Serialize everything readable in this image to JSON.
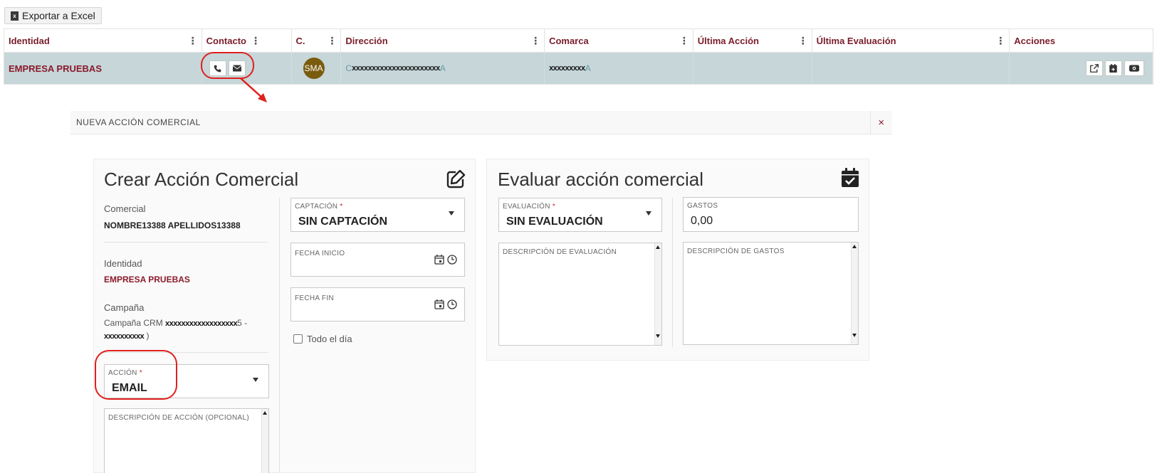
{
  "toolbar": {
    "export_label": "Exportar a Excel"
  },
  "grid": {
    "columns": [
      "Identidad",
      "Contacto",
      "C.",
      "Dirección",
      "Comarca",
      "Última Acción",
      "Última Evaluación",
      "Acciones"
    ],
    "row": {
      "identidad": "EMPRESA PRUEBAS",
      "avatar": "SMA",
      "direccion_masked": "xxxxxxxxxxxxxxxxxxxxxx",
      "direccion_prefix": "C",
      "direccion_tail": "A",
      "comarca_masked": "xxxxxxxxx",
      "comarca_tail": "A",
      "ultima_accion": "",
      "ultima_evaluacion": ""
    }
  },
  "dialog": {
    "title": "NUEVA ACCIÓN COMERCIAL",
    "close_glyph": "×",
    "create": {
      "title": "Crear Acción Comercial",
      "comercial_label": "Comercial",
      "comercial_value": "NOMBRE13388 APELLIDOS13388",
      "identidad_label": "Identidad",
      "identidad_value": "EMPRESA PRUEBAS",
      "campana_label": "Campaña",
      "campana_prefix": "Campaña CRM",
      "campana_masked_1": "xxxxxxxxxxxxxxxxxx",
      "campana_mid": "5 -",
      "campana_masked_2": "xxxxxxxxxx",
      "campana_suffix": ")",
      "accion_label": "ACCIÓN",
      "accion_value": "EMAIL",
      "descripcion_accion_label": "DESCRIPCIÓN DE ACCIÓN (OPCIONAL)",
      "captacion_label": "CAPTACIÓN",
      "captacion_value": "SIN CAPTACIÓN",
      "fecha_inicio_label": "FECHA INICIO",
      "fecha_fin_label": "FECHA FIN",
      "todo_dia_label": "Todo el día",
      "required_mark": "*"
    },
    "evaluate": {
      "title": "Evaluar acción comercial",
      "evaluacion_label": "EVALUACIÓN",
      "evaluacion_value": "SIN EVALUACIÓN",
      "gastos_label": "GASTOS",
      "gastos_value": "0,00",
      "descripcion_evaluacion_label": "DESCRIPCIÓN DE EVALUACIÓN",
      "descripcion_gastos_label": "DESCRIPCIÓN DE GASTOS"
    }
  },
  "colors": {
    "accent": "#8b1a2c",
    "row_bg": "#c6d6d9",
    "highlight": "#e0201c"
  },
  "icons": [
    "excel-icon",
    "kebab-icon",
    "phone-icon",
    "envelope-icon",
    "external-link-icon",
    "calendar-plus-icon",
    "eye-icon",
    "close-icon",
    "edit-icon",
    "calendar-check-icon",
    "calendar-icon",
    "clock-icon",
    "caret-down-icon"
  ]
}
